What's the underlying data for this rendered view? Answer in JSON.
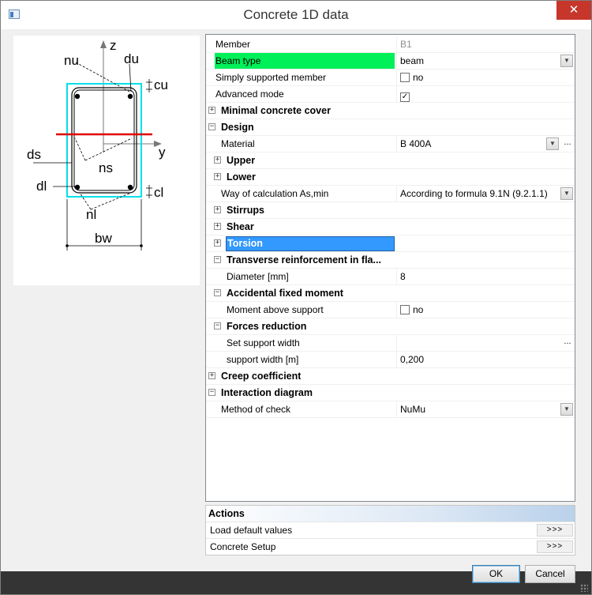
{
  "window": {
    "title": "Concrete 1D data",
    "close_glyph": "✕"
  },
  "diagram": {
    "labels": {
      "z": "z",
      "y": "y",
      "nu": "nu",
      "du": "du",
      "cu": "cu",
      "ds": "ds",
      "ns": "ns",
      "dl": "dl",
      "cl": "cl",
      "nl": "nl",
      "bw": "bw"
    },
    "colors": {
      "outline": "#00e0e8",
      "neutral_axis": "#e00000",
      "line": "#000000"
    }
  },
  "properties": [
    {
      "kind": "prop",
      "indent": 0,
      "name": "Member",
      "value": "B1",
      "value_style": "gray"
    },
    {
      "kind": "prop",
      "indent": 0,
      "name": "Beam type",
      "value": "beam",
      "highlight": "green",
      "control": "dropdown"
    },
    {
      "kind": "prop",
      "indent": 0,
      "name": "Simply supported member",
      "value": "no",
      "control": "checkbox",
      "checked": false
    },
    {
      "kind": "prop",
      "indent": 0,
      "name": "Advanced mode",
      "value": "",
      "control": "checkbox",
      "checked": true
    },
    {
      "kind": "group",
      "indent": 0,
      "name": "Minimal concrete cover",
      "expanded": false
    },
    {
      "kind": "group",
      "indent": 0,
      "name": "Design",
      "expanded": true
    },
    {
      "kind": "prop",
      "indent": 1,
      "name": "Material",
      "value": "B 400A",
      "control": "dropdown-ellipsis"
    },
    {
      "kind": "group",
      "indent": 1,
      "name": "Upper",
      "expanded": false
    },
    {
      "kind": "group",
      "indent": 1,
      "name": "Lower",
      "expanded": false
    },
    {
      "kind": "prop",
      "indent": 1,
      "name": "Way of calculation As,min",
      "value": "According to formula 9.1N (9.2.1.1)",
      "control": "dropdown"
    },
    {
      "kind": "group",
      "indent": 1,
      "name": "Stirrups",
      "expanded": false
    },
    {
      "kind": "group",
      "indent": 1,
      "name": "Shear",
      "expanded": false
    },
    {
      "kind": "group",
      "indent": 1,
      "name": "Torsion",
      "expanded": false,
      "highlight": "blue"
    },
    {
      "kind": "group",
      "indent": 1,
      "name": "Transverse reinforcement in fla...",
      "expanded": true
    },
    {
      "kind": "prop",
      "indent": 2,
      "name": "Diameter [mm]",
      "value": "8"
    },
    {
      "kind": "group",
      "indent": 1,
      "name": "Accidental fixed moment",
      "expanded": true
    },
    {
      "kind": "prop",
      "indent": 2,
      "name": "Moment above support",
      "value": "no",
      "control": "checkbox",
      "checked": false
    },
    {
      "kind": "group",
      "indent": 1,
      "name": "Forces reduction",
      "expanded": true
    },
    {
      "kind": "prop",
      "indent": 2,
      "name": "Set support width",
      "value": "",
      "control": "ellipsis"
    },
    {
      "kind": "prop",
      "indent": 2,
      "name": "support width [m]",
      "value": "0,200"
    },
    {
      "kind": "group",
      "indent": 0,
      "name": "Creep coefficient",
      "expanded": false
    },
    {
      "kind": "group",
      "indent": 0,
      "name": "Interaction diagram",
      "expanded": true
    },
    {
      "kind": "prop",
      "indent": 1,
      "name": "Method of check",
      "value": "NuMu",
      "control": "dropdown"
    }
  ],
  "actions": {
    "header": "Actions",
    "items": [
      {
        "label": "Load default values",
        "button": ">>>"
      },
      {
        "label": "Concrete Setup",
        "button": ">>>"
      }
    ]
  },
  "buttons": {
    "ok": "OK",
    "cancel": "Cancel"
  },
  "glyphs": {
    "collapsed": "+",
    "expanded": "−",
    "dropdown": "▼",
    "ellipsis": "...",
    "check": "✓"
  }
}
